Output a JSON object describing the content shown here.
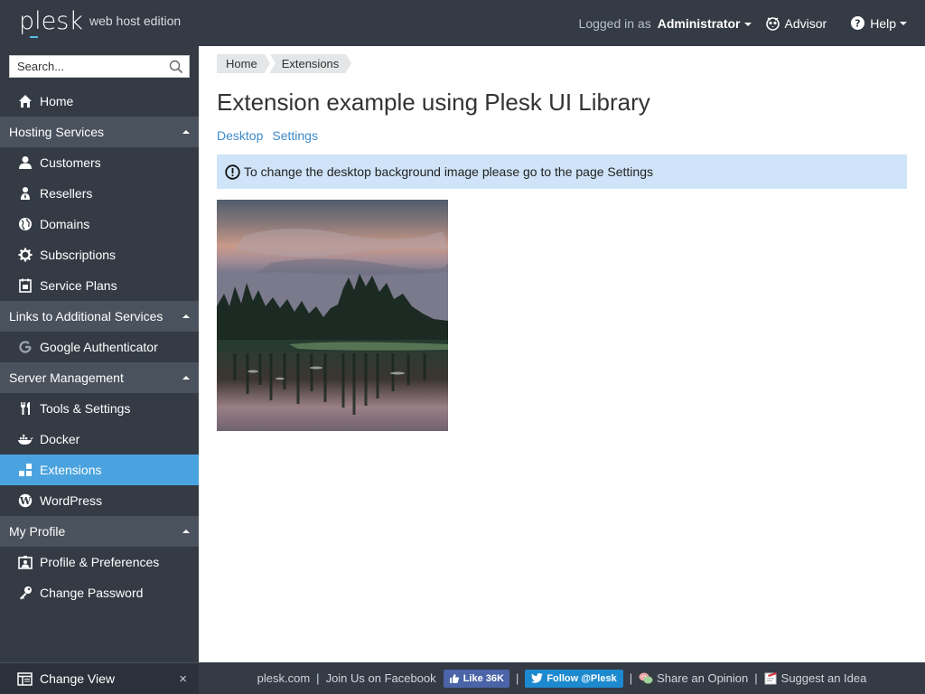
{
  "header": {
    "logo_word": "plesk",
    "logo_edition": "web host edition",
    "logged_in_prefix": "Logged in as",
    "user": "Administrator",
    "advisor_label": "Advisor",
    "help_label": "Help"
  },
  "sidebar": {
    "search_placeholder": "Search...",
    "home": "Home",
    "groups": {
      "hosting": "Hosting Services",
      "links": "Links to Additional Services",
      "server": "Server Management",
      "profile": "My Profile"
    },
    "items": {
      "customers": "Customers",
      "resellers": "Resellers",
      "domains": "Domains",
      "subscriptions": "Subscriptions",
      "service_plans": "Service Plans",
      "google_auth": "Google Authenticator",
      "tools": "Tools & Settings",
      "docker": "Docker",
      "extensions": "Extensions",
      "wordpress": "WordPress",
      "profile_prefs": "Profile & Preferences",
      "change_password": "Change Password"
    },
    "change_view": "Change View",
    "close_symbol": "×"
  },
  "main": {
    "breadcrumb": [
      "Home",
      "Extensions"
    ],
    "title": "Extension example using Plesk UI Library",
    "tabs": [
      "Desktop",
      "Settings"
    ],
    "message": "To change the desktop background image please go to the page Settings"
  },
  "footer": {
    "site": "plesk.com",
    "facebook": "Join Us on Facebook",
    "fb_button": "Like 36K",
    "twitter_button": "Follow @Plesk",
    "opinion": "Share an Opinion",
    "idea": "Suggest an Idea",
    "separator": "|"
  },
  "colors": {
    "chrome": "#343b45",
    "active": "#4aa3df",
    "group": "#4a525d",
    "link": "#3e89c9",
    "info_bg": "#cfe4f8"
  }
}
